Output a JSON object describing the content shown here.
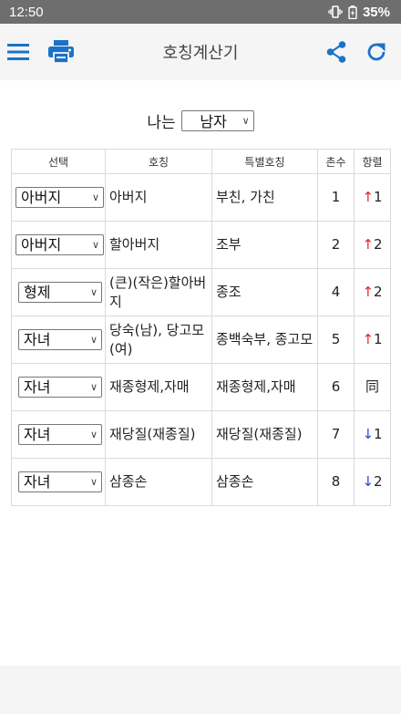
{
  "status_bar": {
    "time": "12:50",
    "battery": "35%"
  },
  "app_bar": {
    "title": "호칭계산기"
  },
  "gender": {
    "prefix": "나는",
    "selected": "남자"
  },
  "table": {
    "headers": {
      "select": "선택",
      "title": "호칭",
      "special": "특별호칭",
      "degree": "촌수",
      "direction": "항렬"
    },
    "rows": [
      {
        "select": "아버지",
        "title": "아버지",
        "special": "부친, 가친",
        "degree": "1",
        "arrow": "↑",
        "level": "1"
      },
      {
        "select": "아버지",
        "title": "할아버지",
        "special": "조부",
        "degree": "2",
        "arrow": "↑",
        "level": "2"
      },
      {
        "select": "형제",
        "title": "(큰)(작은)할아버지",
        "special": "종조",
        "degree": "4",
        "arrow": "↑",
        "level": "2"
      },
      {
        "select": "자녀",
        "title": "당숙(남), 당고모(여)",
        "special": "종백숙부, 종고모",
        "degree": "5",
        "arrow": "↑",
        "level": "1"
      },
      {
        "select": "자녀",
        "title": "재종형제,자매",
        "special": "재종형제,자매",
        "degree": "6",
        "arrow": "",
        "level": "同"
      },
      {
        "select": "자녀",
        "title": "재당질(재종질)",
        "special": "재당질(재종질)",
        "degree": "7",
        "arrow": "↓",
        "level": "1"
      },
      {
        "select": "자녀",
        "title": "삼종손",
        "special": "삼종손",
        "degree": "8",
        "arrow": "↓",
        "level": "2"
      }
    ]
  },
  "colors": {
    "accent": "#1a73c8",
    "up": "#e02424",
    "down": "#2b3fd6",
    "status_bar": "#6e6e6e",
    "app_bar": "#f5f5f5"
  },
  "icons": {
    "menu": "hamburger-menu-icon",
    "print": "printer-icon",
    "share": "share-icon",
    "refresh": "refresh-icon"
  }
}
